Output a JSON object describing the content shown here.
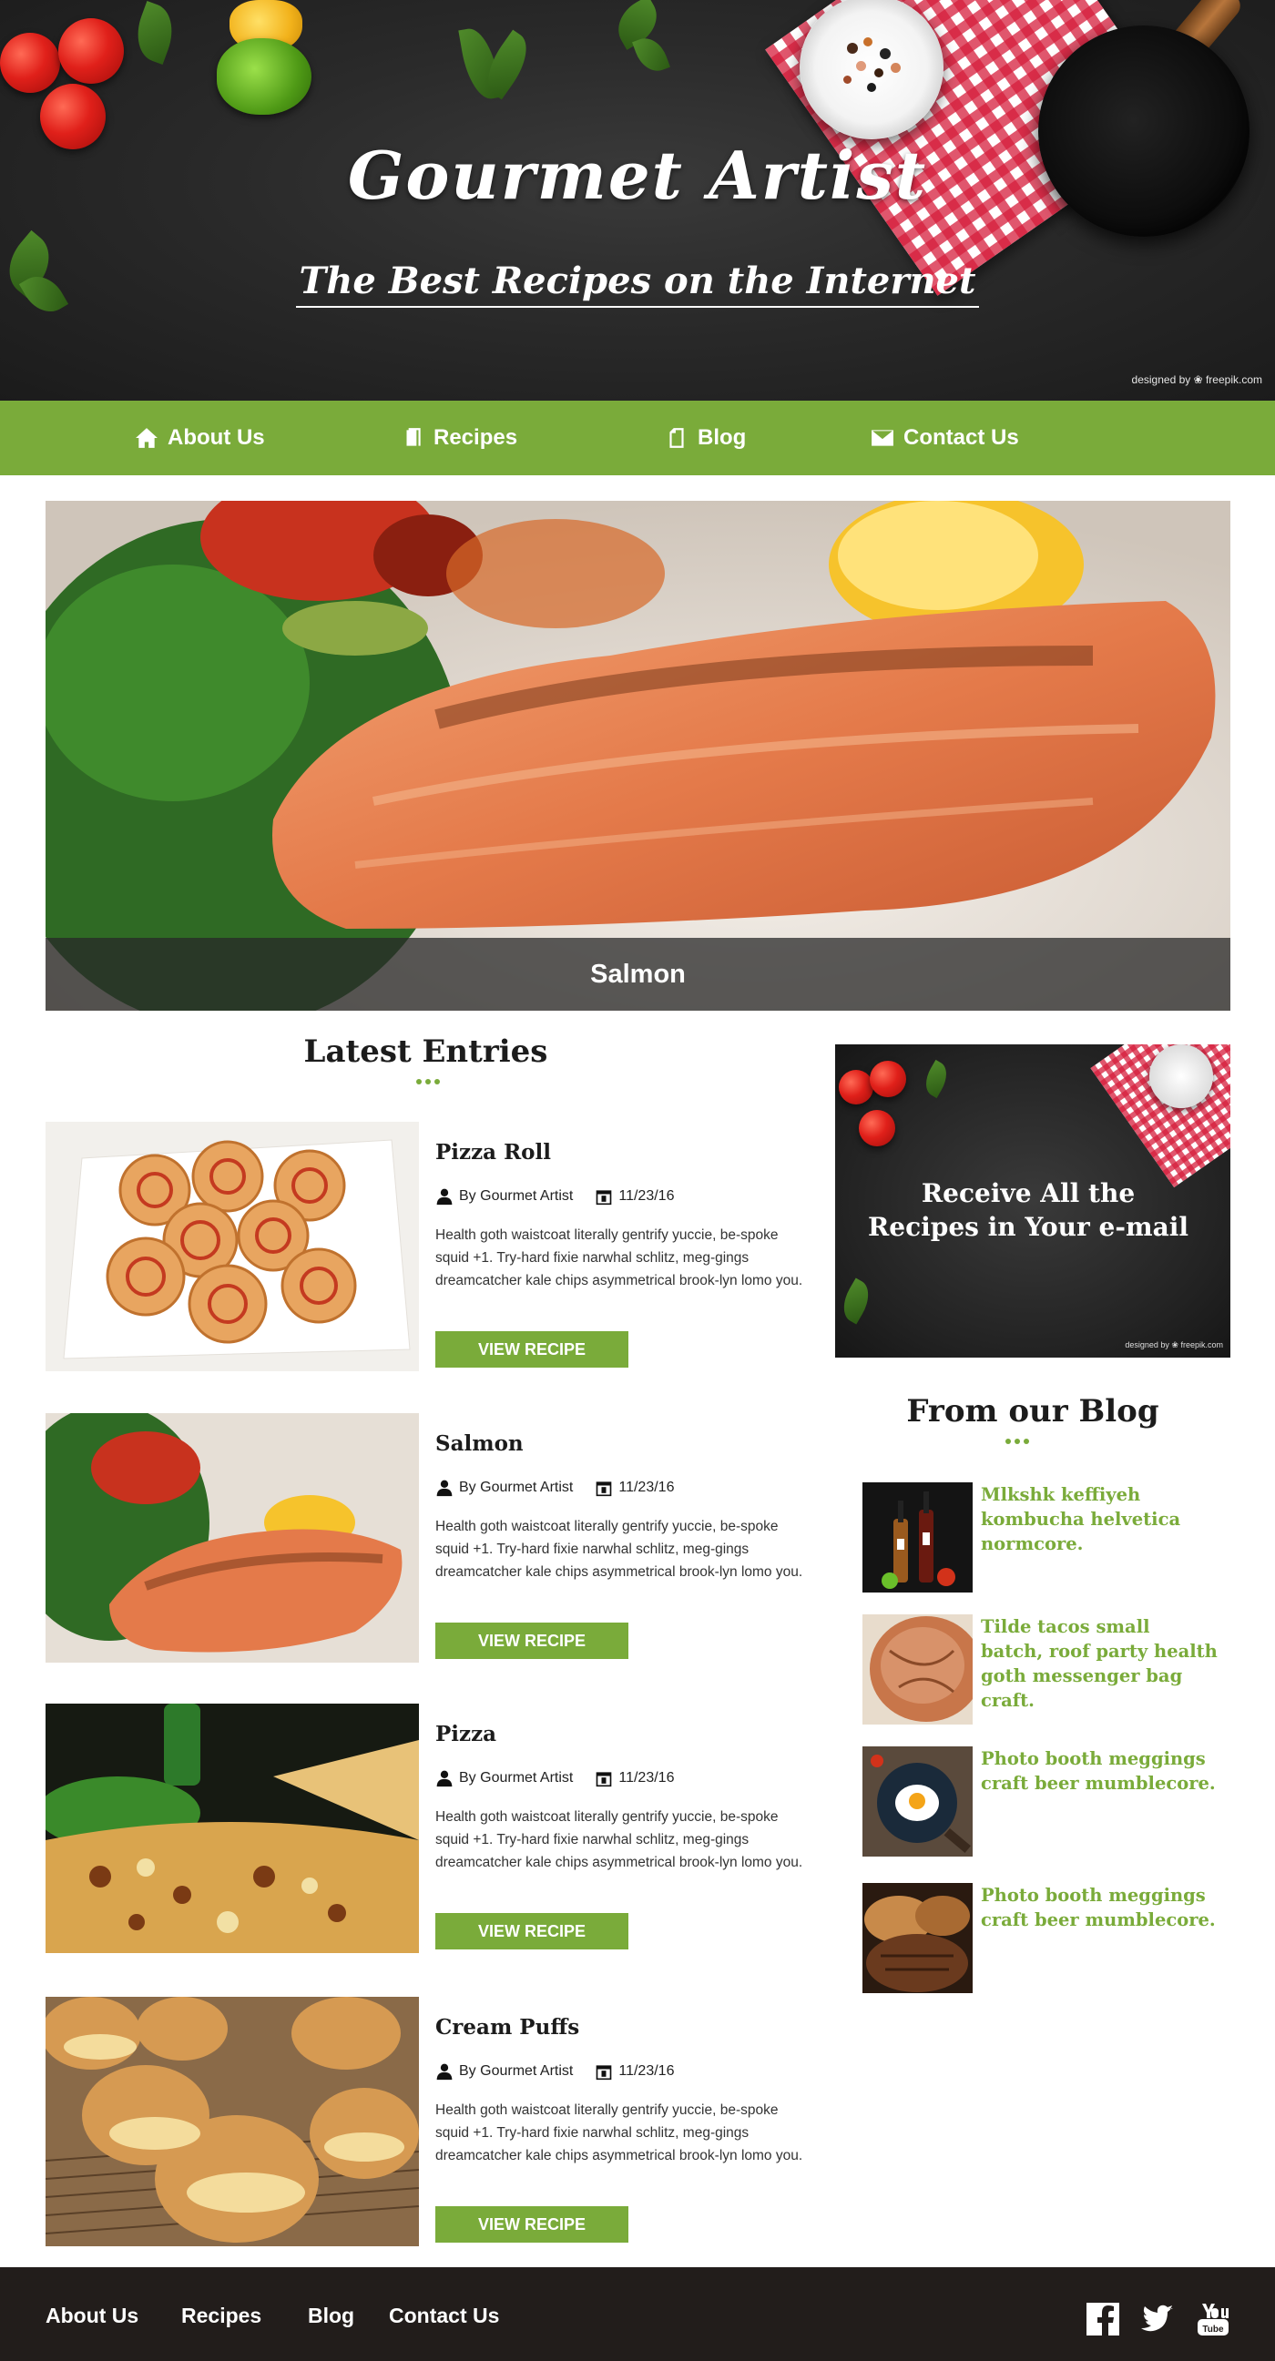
{
  "header": {
    "title": "Gourmet Artist",
    "tagline": "The Best Recipes on the Internet",
    "credit": "designed by ❀ freepik.com"
  },
  "nav": {
    "items": [
      {
        "label": "About Us",
        "icon": "home-icon"
      },
      {
        "label": "Recipes",
        "icon": "document-icon"
      },
      {
        "label": "Blog",
        "icon": "page-icon"
      },
      {
        "label": "Contact Us",
        "icon": "envelope-icon"
      }
    ]
  },
  "featured": {
    "caption": "Salmon"
  },
  "latest": {
    "title": "Latest Entries",
    "entries": [
      {
        "title": "Pizza Roll",
        "author": "By Gourmet Artist",
        "date": "11/23/16",
        "text": "Health goth waistcoat literally gentrify yuccie, be-spoke squid +1. Try-hard fixie narwhal schlitz, meg-gings dreamcatcher kale chips asymmetrical brook-lyn lomo you.",
        "button": "VIEW RECIPE"
      },
      {
        "title": "Salmon",
        "author": "By Gourmet Artist",
        "date": "11/23/16",
        "text": "Health goth waistcoat literally gentrify yuccie, be-spoke squid +1. Try-hard fixie narwhal schlitz, meg-gings dreamcatcher kale chips asymmetrical brook-lyn lomo you.",
        "button": "VIEW RECIPE"
      },
      {
        "title": "Pizza",
        "author": "By Gourmet Artist",
        "date": "11/23/16",
        "text": "Health goth waistcoat literally gentrify yuccie, be-spoke squid +1. Try-hard fixie narwhal schlitz, meg-gings dreamcatcher kale chips asymmetrical brook-lyn lomo you.",
        "button": "VIEW RECIPE"
      },
      {
        "title": "Cream Puffs",
        "author": "By Gourmet Artist",
        "date": "11/23/16",
        "text": "Health goth waistcoat literally gentrify yuccie, be-spoke squid +1. Try-hard fixie narwhal schlitz, meg-gings dreamcatcher kale chips asymmetrical brook-lyn lomo you.",
        "button": "VIEW RECIPE"
      }
    ]
  },
  "newsletter": {
    "text": "Receive All the Recipes in Your e-mail",
    "credit": "designed by ❀ freepik.com"
  },
  "blog": {
    "title": "From our Blog",
    "posts": [
      {
        "title": "Mlkshk keffiyeh kombucha helvetica normcore."
      },
      {
        "title": "Tilde tacos small batch, roof party health goth messenger bag craft."
      },
      {
        "title": "Photo booth meggings craft beer mumblecore."
      },
      {
        "title": "Photo booth meggings craft beer mumblecore."
      }
    ]
  },
  "footer": {
    "links": [
      "About Us",
      "Recipes",
      "Blog",
      "Contact Us"
    ],
    "social": [
      "facebook-icon",
      "twitter-icon",
      "youtube-icon"
    ]
  },
  "colors": {
    "accent": "#7aab3a",
    "header_bg": "#2a2a2a",
    "footer_bg": "#221d1b"
  }
}
